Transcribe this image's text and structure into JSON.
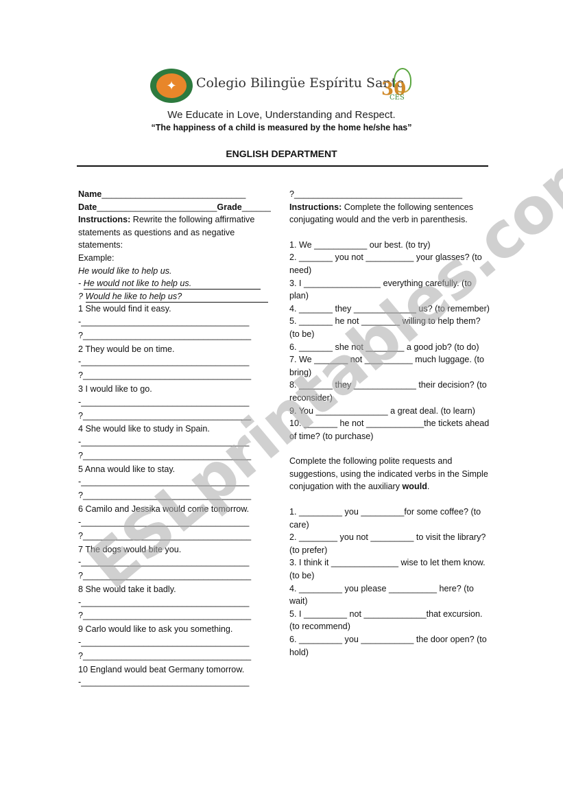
{
  "header": {
    "school_name": "Colegio Bilingüe Espíritu Santo",
    "anniversary_badge": {
      "number": "30",
      "text": "CES"
    },
    "motto": "We Educate in Love, Understanding and Respect.",
    "quote": "“The happiness of a child is measured by the home he/she has”",
    "department": "ENGLISH DEPARTMENT",
    "colors": {
      "logo_green": "#2d7a3e",
      "logo_orange": "#e8862a"
    }
  },
  "left": {
    "name_label": "Name",
    "name_blank": "______________________________",
    "date_label": "Date",
    "date_blank": "_________________________",
    "grade_label": "Grade",
    "grade_blank": "______",
    "instructions_label": "Instructions:",
    "instructions_text": " Rewrite the following affirmative statements as questions and as negative statements:",
    "example_label": "Example:",
    "example_sentence": "He would like to help us.",
    "example_negative_prefix": "-",
    "example_negative": "He would not like to help us.",
    "example_question_prefix": "?",
    "example_question": "Would he like to help us?",
    "negative_blank": "-___________________________________",
    "question_blank": "?___________________________________",
    "items": [
      "1 She would find it easy.",
      "2 They would be on time.",
      "3 I would like to go.",
      "4 She would like to study in Spain.",
      " 5 Anna would like to stay.",
      "6 Camilo and Jessika would come tomorrow.",
      "7 The dogs would bite you.",
      " 8 She would take it badly.",
      "9 Carlo would like to ask you something.",
      "10 England would beat Germany tomorrow."
    ]
  },
  "right": {
    "carryover_blank": "?___________________________________",
    "instructions_label": "Instructions:",
    "instructions_text": " Complete the following sentences conjugating would and the verb in parenthesis.",
    "section1": [
      "1.  We ___________ our best. (to try)",
      "2. _______ you not __________ your glasses? (to need)",
      "3. I ________________ everything carefully. (to plan)",
      "4. _______ they _____________ us? (to remember)",
      "5. _______ he not ________ willing to help them? (to be)",
      "6. _______ she not ________ a good job? (to do)",
      "7. We _______ not __________ much luggage. (to bring)",
      "8. _______ they _____________ their decision? (to reconsider)",
      "9. You _______________ a great deal. (to learn)",
      "10. _______ he not ____________the tickets ahead of time? (to purchase)"
    ],
    "section2_intro": "Complete the following polite requests and suggestions, using the indicated verbs in the Simple conjugation with the auxiliary ",
    "section2_intro_bold": "would",
    "section2_intro_end": ".",
    "section2": [
      "1. _________ you _________for some coffee? (to care)",
      "2. ________ you not _________ to visit the library? (to prefer)",
      "3. I think it ______________ wise to let them know. (to be)",
      "4. _________ you please __________ here? (to wait)",
      "5. I _________ not _____________that excursion. (to recommend)",
      "6. _________ you ___________ the door open? (to hold)"
    ]
  },
  "watermark": "ESLprintables.com"
}
